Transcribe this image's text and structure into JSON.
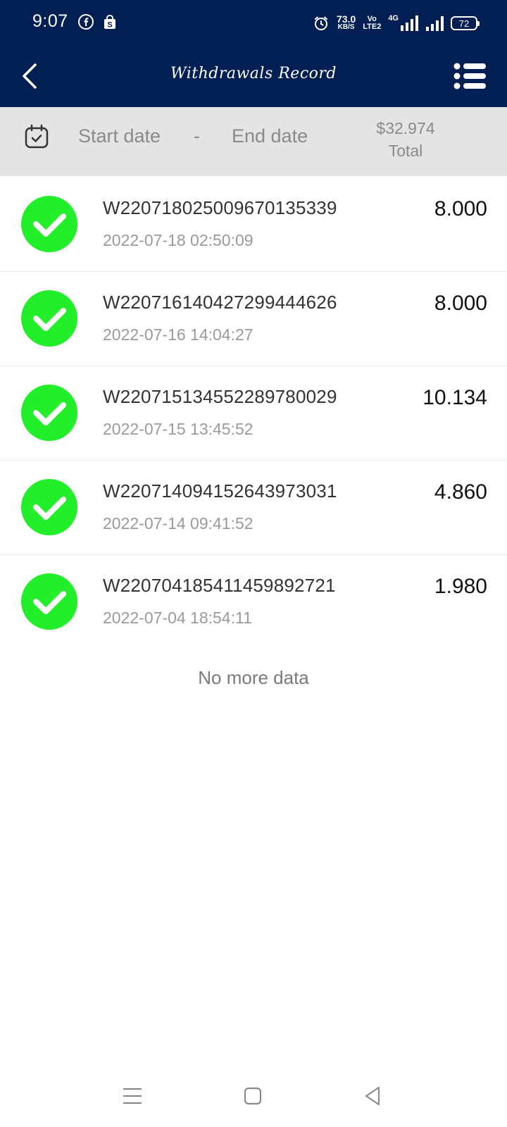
{
  "status_bar": {
    "time": "9:07",
    "left_icons": [
      "facebook-icon",
      "shopping-bag-icon"
    ],
    "speed_value": "73.0",
    "speed_unit": "KB/S",
    "volte_top": "Vo",
    "volte_bottom": "LTE2",
    "network_type": "4G",
    "battery": "72",
    "bar_color": "#011f52"
  },
  "header": {
    "title": "Withdrawals Record",
    "back_icon": "chevron-left-icon",
    "menu_icon": "list-menu-icon"
  },
  "filter": {
    "calendar_icon": "calendar-check-icon",
    "start_placeholder": "Start date",
    "separator": "-",
    "end_placeholder": "End date",
    "total_amount": "$32.974",
    "total_label": "Total"
  },
  "records": [
    {
      "id": "W220718025009670135339",
      "time": "2022-07-18 02:50:09",
      "amount": "8.000",
      "status_icon": "check-circle-icon"
    },
    {
      "id": "W220716140427299444626",
      "time": "2022-07-16 14:04:27",
      "amount": "8.000",
      "status_icon": "check-circle-icon"
    },
    {
      "id": "W220715134552289780029",
      "time": "2022-07-15 13:45:52",
      "amount": "10.134",
      "status_icon": "check-circle-icon"
    },
    {
      "id": "W220714094152643973031",
      "time": "2022-07-14 09:41:52",
      "amount": "4.860",
      "status_icon": "check-circle-icon"
    },
    {
      "id": "W220704185411459892721",
      "time": "2022-07-04 18:54:11",
      "amount": "1.980",
      "status_icon": "check-circle-icon"
    }
  ],
  "list_footer": "No more data",
  "colors": {
    "success_green": "#22ee2a",
    "header_navy": "#011f52",
    "filter_gray": "#e4e4e4"
  },
  "nav_bar": {
    "icons": [
      "recent-apps-icon",
      "home-icon",
      "back-triangle-icon"
    ]
  }
}
